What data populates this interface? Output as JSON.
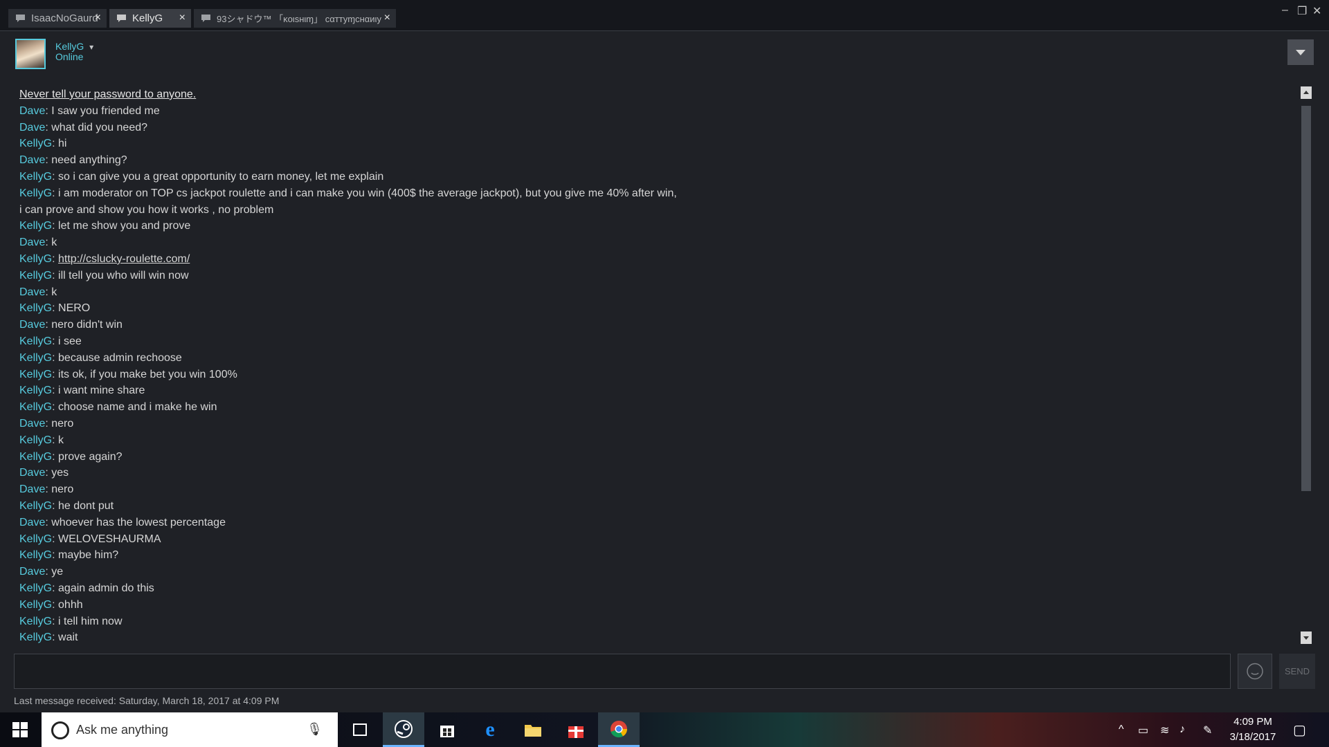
{
  "tabs": [
    {
      "label": "IsaacNoGaurd",
      "close": "×"
    },
    {
      "label": "KellyG",
      "close": "×",
      "active": true
    },
    {
      "label": "93シャドウ™ 「ĸoιѕнιɱ」 cαттуɱcнαиιу",
      "close": "×"
    }
  ],
  "window_controls": {
    "minimize": "–",
    "restore": "❐",
    "close": "✕"
  },
  "header": {
    "username": "KellyG",
    "status": "Online",
    "dropdown_glyph": "▾"
  },
  "chat": {
    "warning": "Never tell your password to anyone.",
    "messages": [
      {
        "speaker": "Dave",
        "text": "I saw you friended me"
      },
      {
        "speaker": "Dave",
        "text": "what did you need?"
      },
      {
        "speaker": "KellyG",
        "text": "hi"
      },
      {
        "speaker": "Dave",
        "text": "need anything?"
      },
      {
        "speaker": "KellyG",
        "text": "so i can give you a great opportunity to earn money, let me explain"
      },
      {
        "speaker": "KellyG",
        "text": "i am moderator on TOP cs jackpot roulette and i can make you win (400$ the average jackpot), but you give me 40% after win,"
      },
      {
        "speaker": "",
        "text": "i can prove and show you how it works , no problem"
      },
      {
        "speaker": "KellyG",
        "text": "let me show you and prove"
      },
      {
        "speaker": "Dave",
        "text": "k"
      },
      {
        "speaker": "KellyG",
        "text": "http://cslucky-roulette.com/",
        "link": true
      },
      {
        "speaker": "KellyG",
        "text": "ill tell you who will win now"
      },
      {
        "speaker": "Dave",
        "text": "k"
      },
      {
        "speaker": "KellyG",
        "text": "NERO"
      },
      {
        "speaker": "Dave",
        "text": "nero didn't win"
      },
      {
        "speaker": "KellyG",
        "text": "i see"
      },
      {
        "speaker": "KellyG",
        "text": "because admin rechoose"
      },
      {
        "speaker": "KellyG",
        "text": "its ok, if you make bet you win 100%"
      },
      {
        "speaker": "KellyG",
        "text": "i want mine share"
      },
      {
        "speaker": "KellyG",
        "text": "choose name and i make he win"
      },
      {
        "speaker": "Dave",
        "text": "nero"
      },
      {
        "speaker": "KellyG",
        "text": "k"
      },
      {
        "speaker": "KellyG",
        "text": "prove again?"
      },
      {
        "speaker": "Dave",
        "text": "yes"
      },
      {
        "speaker": "Dave",
        "text": "nero"
      },
      {
        "speaker": "KellyG",
        "text": "he dont put"
      },
      {
        "speaker": "Dave",
        "text": "whoever has the lowest percentage"
      },
      {
        "speaker": "KellyG",
        "text": "WELOVESHAURMA"
      },
      {
        "speaker": "KellyG",
        "text": "maybe him?"
      },
      {
        "speaker": "Dave",
        "text": "ye"
      },
      {
        "speaker": "KellyG",
        "text": "again admin do this"
      },
      {
        "speaker": "KellyG",
        "text": "ohhh"
      },
      {
        "speaker": "KellyG",
        "text": "i tell him now"
      },
      {
        "speaker": "KellyG",
        "text": "wait"
      }
    ]
  },
  "composer": {
    "send_label": "SEND",
    "last_message": "Last message received: Saturday, March 18, 2017 at 4:09 PM"
  },
  "taskbar": {
    "search_placeholder": "Ask me anything",
    "time": "4:09 PM",
    "date": "3/18/2017",
    "apps": [
      "task-view",
      "steam",
      "store",
      "edge",
      "file-explorer",
      "gift",
      "chrome"
    ]
  },
  "colors": {
    "accent": "#57cbde",
    "background": "#1f2126",
    "text": "#d6d6d6"
  }
}
